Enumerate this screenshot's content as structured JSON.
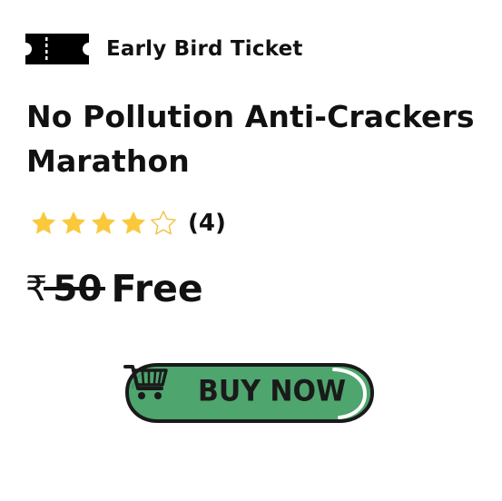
{
  "ticket": {
    "icon": "ticket-icon",
    "label": "Early Bird Ticket"
  },
  "event": {
    "title": "No Pollution Anti-Crackers Marathon"
  },
  "rating": {
    "value": 4,
    "max": 5,
    "count_text": "(4)",
    "star_color": "#f9c93b"
  },
  "price": {
    "currency_symbol": "₹",
    "original": "50",
    "current": "Free"
  },
  "cta": {
    "label": "BUY NOW",
    "icon": "shopping-cart-icon",
    "background_color": "#4ea56e",
    "border_color": "#1a1a1a"
  }
}
